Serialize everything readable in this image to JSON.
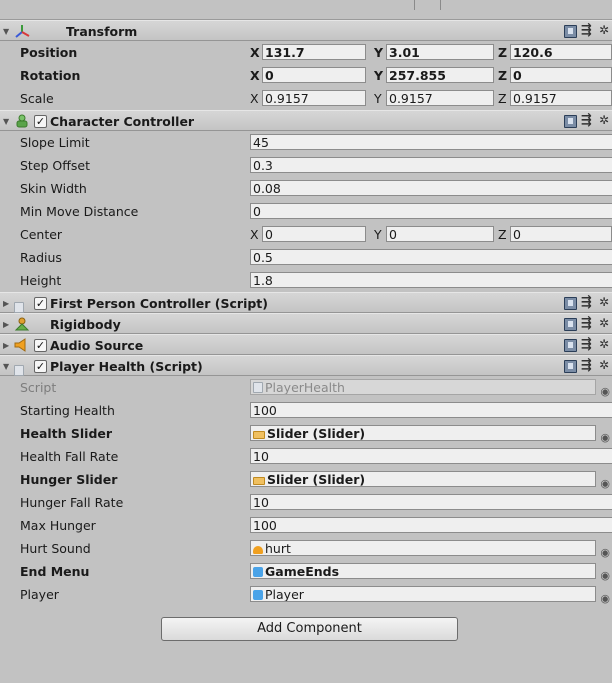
{
  "transform": {
    "title": "Transform",
    "position": {
      "label": "Position",
      "x": "131.7",
      "y": "3.01",
      "z": "120.6"
    },
    "rotation": {
      "label": "Rotation",
      "x": "0",
      "y": "257.855",
      "z": "0"
    },
    "scale": {
      "label": "Scale",
      "x": "0.9157",
      "y": "0.9157",
      "z": "0.9157"
    }
  },
  "axes": {
    "x": "X",
    "y": "Y",
    "z": "Z"
  },
  "character_controller": {
    "title": "Character Controller",
    "fields": [
      {
        "label": "Slope Limit",
        "value": "45"
      },
      {
        "label": "Step Offset",
        "value": "0.3"
      },
      {
        "label": "Skin Width",
        "value": "0.08"
      },
      {
        "label": "Min Move Distance",
        "value": "0"
      }
    ],
    "center": {
      "label": "Center",
      "x": "0",
      "y": "0",
      "z": "0"
    },
    "radius": {
      "label": "Radius",
      "value": "0.5"
    },
    "height": {
      "label": "Height",
      "value": "1.8"
    }
  },
  "collapsed": {
    "first_person": "First Person Controller (Script)",
    "rigidbody": "Rigidbody",
    "audio_source": "Audio Source"
  },
  "player_health": {
    "title": "Player Health (Script)",
    "script": {
      "label": "Script",
      "value": "PlayerHealth"
    },
    "starting_health": {
      "label": "Starting Health",
      "value": "100"
    },
    "health_slider": {
      "label": "Health Slider",
      "value": "Slider (Slider)"
    },
    "health_fall_rate": {
      "label": "Health Fall Rate",
      "value": "10"
    },
    "hunger_slider": {
      "label": "Hunger Slider",
      "value": "Slider (Slider)"
    },
    "hunger_fall_rate": {
      "label": "Hunger Fall Rate",
      "value": "10"
    },
    "max_hunger": {
      "label": "Max Hunger",
      "value": "100"
    },
    "hurt_sound": {
      "label": "Hurt Sound",
      "value": "hurt"
    },
    "end_menu": {
      "label": "End Menu",
      "value": "GameEnds"
    },
    "player": {
      "label": "Player",
      "value": "Player"
    }
  },
  "add_component_label": "Add Component",
  "icons": {
    "transform": "transform-axes-icon",
    "character_controller": "character-controller-icon",
    "script": "script-icon",
    "rigidbody": "rigidbody-icon",
    "audio": "audio-source-icon",
    "help": "help-book-icon",
    "settings": "gear-icon"
  },
  "colors": {
    "panel": "#c2c2c2",
    "field": "#efefef",
    "header": "#d0d0d0"
  }
}
